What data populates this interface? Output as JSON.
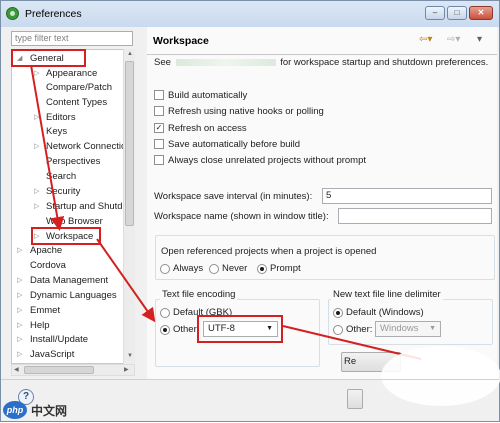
{
  "window": {
    "title": "Preferences",
    "minimize": "–",
    "maximize": "□",
    "close": "✕"
  },
  "filter": {
    "placeholder": "type filter text"
  },
  "tree": {
    "general": "General",
    "children": [
      "Appearance",
      "Compare/Patch",
      "Content Types",
      "Editors",
      "Keys",
      "Network Connectio",
      "Perspectives",
      "Search",
      "Security",
      "Startup and Shutd",
      "Web Browser",
      "Workspace"
    ],
    "roots": [
      "Apache",
      "Cordova",
      "Data Management",
      "Dynamic Languages",
      "Emmet",
      "Help",
      "Install/Update",
      "JavaScript"
    ]
  },
  "page": {
    "title": "Workspace",
    "desc_prefix": "See",
    "desc_suffix": "for workspace startup and shutdown preferences.",
    "checkboxes": [
      {
        "label": "Build automatically",
        "checked": false
      },
      {
        "label": "Refresh using native hooks or polling",
        "checked": false
      },
      {
        "label": "Refresh on access",
        "checked": true
      },
      {
        "label": "Save automatically before build",
        "checked": false
      },
      {
        "label": "Always close unrelated projects without prompt",
        "checked": false
      }
    ],
    "save_interval_label": "Workspace save interval (in minutes):",
    "save_interval_value": "5",
    "workspace_name_label": "Workspace name (shown in window title):",
    "workspace_name_value": "",
    "open_ref_label": "Open referenced projects when a project is opened",
    "open_ref_options": [
      "Always",
      "Never",
      "Prompt"
    ],
    "open_ref_selected": "Prompt",
    "encoding": {
      "group": "Text file encoding",
      "default": "Default (GBK)",
      "other": "Other:",
      "value": "UTF-8"
    },
    "delimiter": {
      "group": "New text file line delimiter",
      "default": "Default (Windows)",
      "other": "Other:",
      "value": "Windows"
    },
    "restore_button": "Re",
    "help": "?"
  },
  "watermark": {
    "logo": "php",
    "text": "中文网"
  },
  "colors": {
    "annotation": "#d42020",
    "accent": "#3399ff"
  }
}
